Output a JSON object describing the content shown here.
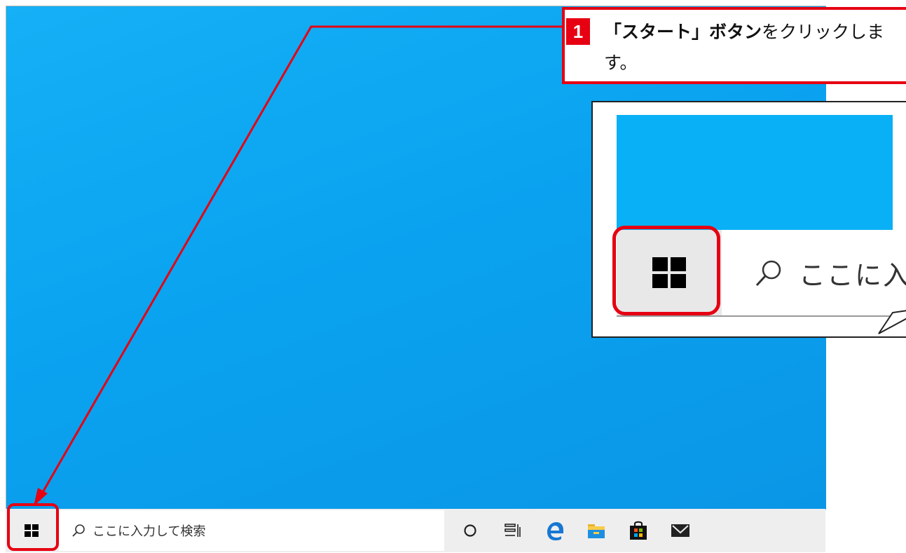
{
  "taskbar": {
    "search_placeholder": "ここに入力して検索",
    "icons": [
      "cortana-icon",
      "task-view-icon",
      "edge-icon",
      "file-explorer-icon",
      "store-icon",
      "mail-icon"
    ]
  },
  "callout": {
    "step_number": "1",
    "text_bold": "「スタート」ボタン",
    "text_rest": "をクリックします。"
  },
  "zoom": {
    "search_text": "ここに入"
  },
  "colors": {
    "highlight": "#e60012",
    "desktop": "#0aa3f0",
    "taskbar": "#eeeeee"
  }
}
